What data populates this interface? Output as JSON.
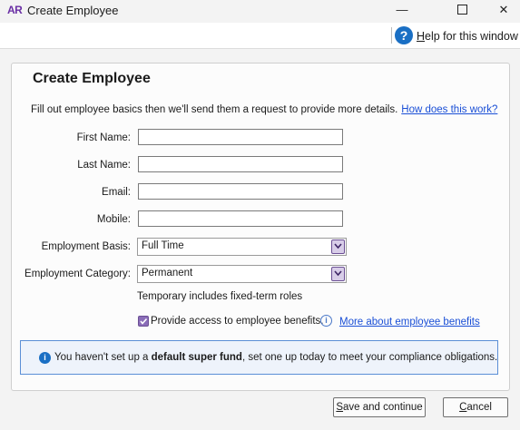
{
  "window": {
    "app_badge": "AR",
    "title": "Create Employee",
    "controls": {
      "minimize": "—",
      "maximize": "",
      "close": "✕"
    }
  },
  "help": {
    "icon": "?",
    "label_prefix": "",
    "label_u": "H",
    "label_rest": "elp for this window"
  },
  "form": {
    "title": "Create Employee",
    "intro": "Fill out employee basics then we'll send them a request to provide more details.",
    "intro_link": "How does this work?",
    "fields": {
      "first_name": {
        "label": "First Name:",
        "value": ""
      },
      "last_name": {
        "label": "Last Name:",
        "value": ""
      },
      "email": {
        "label": "Email:",
        "value": ""
      },
      "mobile": {
        "label": "Mobile:",
        "value": ""
      },
      "basis": {
        "label": "Employment Basis:",
        "value": "Full Time"
      },
      "category": {
        "label": "Employment Category:",
        "value": "Permanent"
      }
    },
    "category_hint": "Temporary includes fixed-term roles",
    "benefits": {
      "checked": true,
      "label": "Provide access to employee benefits.",
      "link": "More about employee benefits"
    }
  },
  "notice": {
    "before": "You haven't set up a ",
    "bold": "default super fund",
    "after": ", set one up today to meet your compliance obligations."
  },
  "buttons": {
    "save_u": "S",
    "save_rest": "ave and continue",
    "cancel_u": "C",
    "cancel_rest": "ancel"
  },
  "colors": {
    "accent": "#6b4f94",
    "link": "#1a4fd6",
    "help_blue": "#1a6fc4"
  }
}
